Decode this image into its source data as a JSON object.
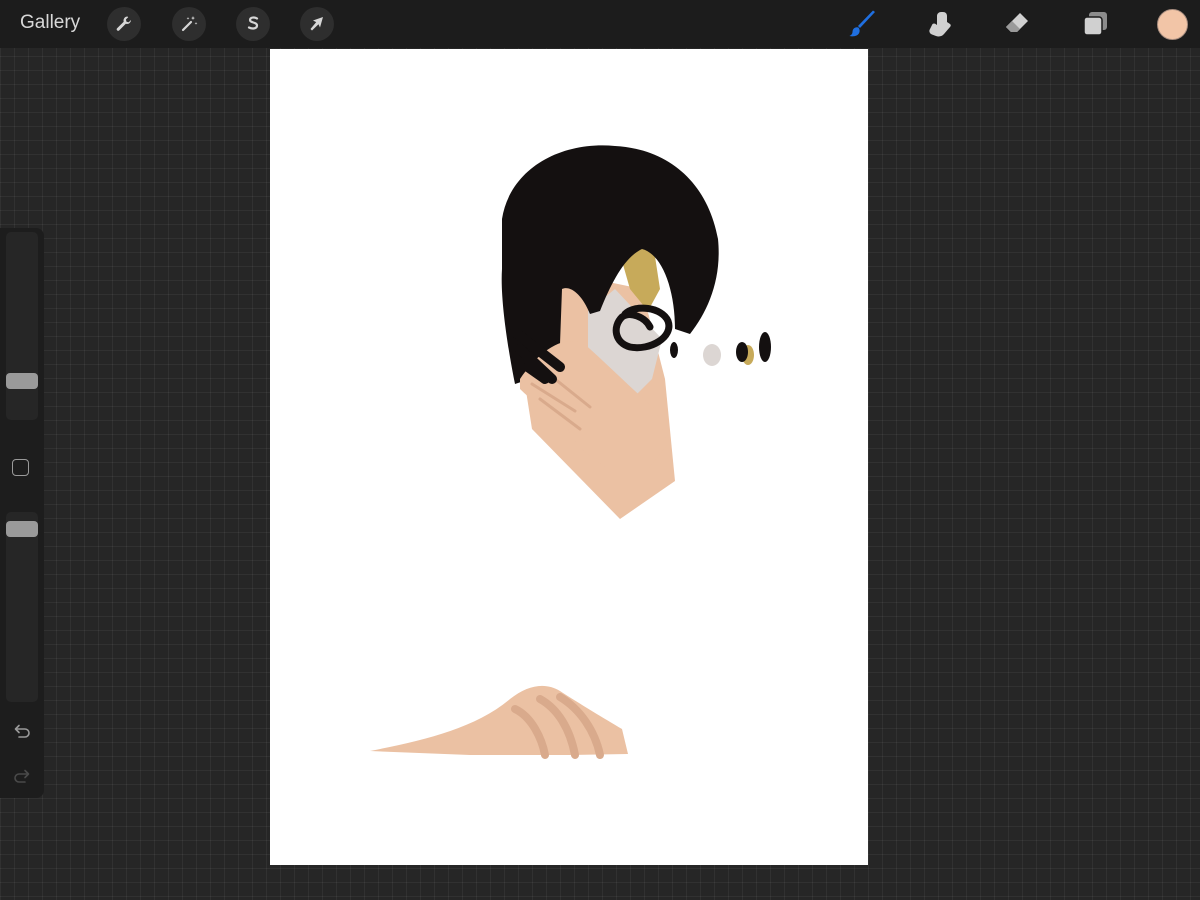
{
  "app": {
    "gallery_label": "Gallery"
  },
  "toolbar": {
    "left_tools": [
      {
        "name": "actions",
        "icon": "wrench-icon"
      },
      {
        "name": "adjustments",
        "icon": "magic-wand-icon"
      },
      {
        "name": "selection",
        "icon": "selection-s-icon"
      },
      {
        "name": "transform",
        "icon": "arrow-cursor-icon"
      }
    ],
    "right_tools": [
      {
        "name": "brush",
        "icon": "brush-icon",
        "active": true
      },
      {
        "name": "smudge",
        "icon": "smudge-finger-icon"
      },
      {
        "name": "eraser",
        "icon": "eraser-icon"
      },
      {
        "name": "layers",
        "icon": "layers-icon"
      }
    ],
    "current_color": "#f2c5a7",
    "active_color": "#1f6fe0"
  },
  "sidebar": {
    "brush_size_level": 0.18,
    "opacity_level": 0.95,
    "icons": [
      "modify-square-icon",
      "undo-icon",
      "redo-icon"
    ]
  },
  "artwork": {
    "skin": "#ebc1a3",
    "skin_shadow": "#d9aa8c",
    "hair": "#141010",
    "accent": "#c7aa5a",
    "grey": "#dcd6d3"
  }
}
